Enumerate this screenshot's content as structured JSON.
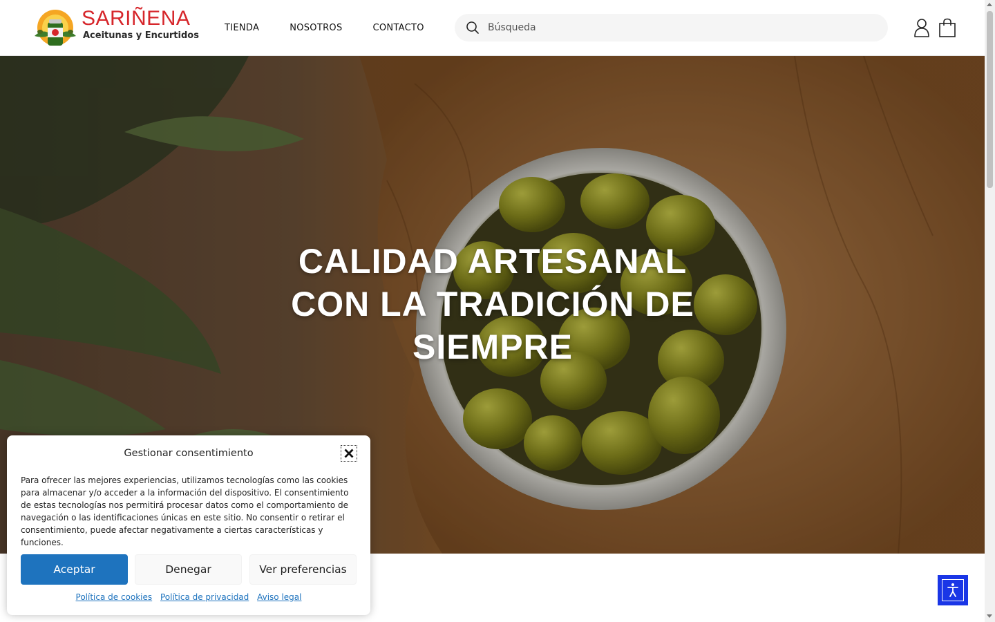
{
  "header": {
    "logo": {
      "name": "SARIÑENA",
      "tagline": "Aceitunas y Encurtidos"
    },
    "nav": [
      {
        "label": "TIENDA"
      },
      {
        "label": "NOSOTROS"
      },
      {
        "label": "CONTACTO"
      }
    ],
    "search": {
      "placeholder": "Búsqueda",
      "icon": "search-icon"
    },
    "icons": {
      "account": "user-icon",
      "cart": "shopping-bag-icon"
    }
  },
  "hero": {
    "title_lines": [
      "CALIDAD ARTESANAL",
      "CON LA TRADICIÓN DE",
      "SIEMPRE"
    ]
  },
  "cookie_banner": {
    "title": "Gestionar consentimiento",
    "close_icon": "close-icon",
    "text": "Para ofrecer las mejores experiencias, utilizamos tecnologías como las cookies para almacenar y/o acceder a la información del dispositivo. El consentimiento de estas tecnologías nos permitirá procesar datos como el comportamiento de navegación o las identificaciones únicas en este sitio. No consentir o retirar el consentimiento, puede afectar negativamente a ciertas características y funciones.",
    "buttons": {
      "accept": "Aceptar",
      "deny": "Denegar",
      "preferences": "Ver preferencias"
    },
    "links": [
      "Política de cookies",
      "Política de privacidad",
      "Aviso legal"
    ]
  },
  "accessibility": {
    "icon": "accessibility-icon"
  },
  "colors": {
    "brand_red": "#d6262b",
    "accept_blue": "#1e73be",
    "a11y_blue": "#1a36e6"
  }
}
